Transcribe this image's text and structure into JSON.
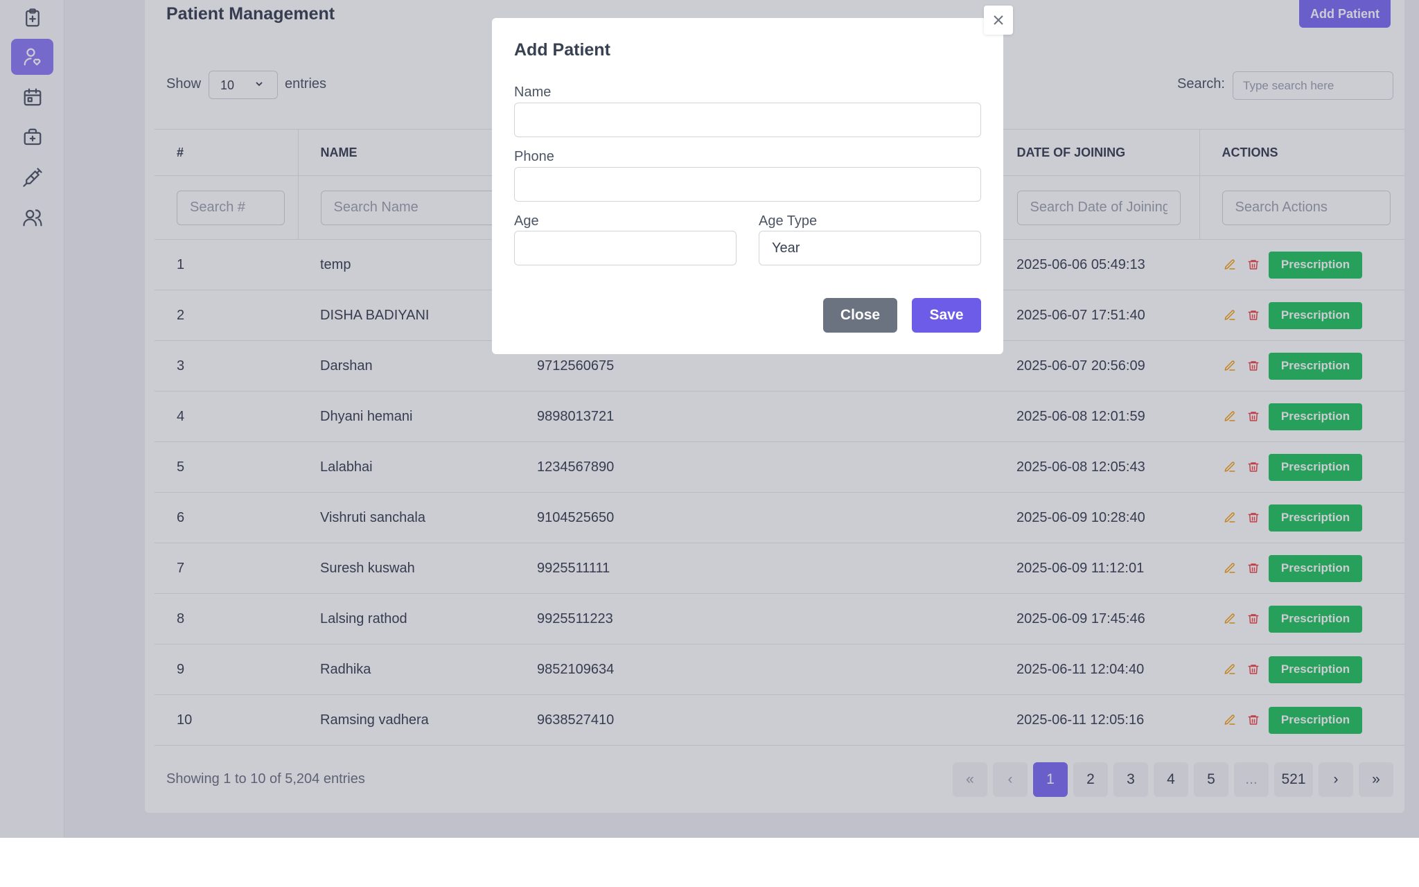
{
  "sidebar": {
    "items": [
      {
        "icon": "clipboard-icon",
        "active": false
      },
      {
        "icon": "user-heart-icon",
        "active": true
      },
      {
        "icon": "calendar-icon",
        "active": false
      },
      {
        "icon": "medical-bag-icon",
        "active": false
      },
      {
        "icon": "syringe-icon",
        "active": false
      },
      {
        "icon": "users-icon",
        "active": false
      }
    ]
  },
  "header": {
    "title": "Patient Management",
    "add_button": "Add Patient"
  },
  "controls": {
    "show_label": "Show",
    "entries_value": "10",
    "entries_label": "entries",
    "search_label": "Search:",
    "search_placeholder": "Type search here"
  },
  "table": {
    "columns": [
      "#",
      "NAME",
      "",
      "DATE OF JOINING",
      "ACTIONS"
    ],
    "filters": [
      "Search #",
      "Search Name",
      "",
      "Search Date of Joining",
      "Search Actions"
    ],
    "action_label": "Prescription",
    "rows": [
      {
        "num": "1",
        "name": "temp",
        "phone": "",
        "date": "2025-06-06 05:49:13"
      },
      {
        "num": "2",
        "name": "DISHA BADIYANI",
        "phone": "",
        "date": "2025-06-07 17:51:40"
      },
      {
        "num": "3",
        "name": "Darshan",
        "phone": "9712560675",
        "date": "2025-06-07 20:56:09"
      },
      {
        "num": "4",
        "name": "Dhyani hemani",
        "phone": "9898013721",
        "date": "2025-06-08 12:01:59"
      },
      {
        "num": "5",
        "name": "Lalabhai",
        "phone": "1234567890",
        "date": "2025-06-08 12:05:43"
      },
      {
        "num": "6",
        "name": "Vishruti sanchala",
        "phone": "9104525650",
        "date": "2025-06-09 10:28:40"
      },
      {
        "num": "7",
        "name": "Suresh kuswah",
        "phone": "9925511111",
        "date": "2025-06-09 11:12:01"
      },
      {
        "num": "8",
        "name": "Lalsing rathod",
        "phone": "9925511223",
        "date": "2025-06-09 17:45:46"
      },
      {
        "num": "9",
        "name": "Radhika",
        "phone": "9852109634",
        "date": "2025-06-11 12:04:40"
      },
      {
        "num": "10",
        "name": "Ramsing vadhera",
        "phone": "9638527410",
        "date": "2025-06-11 12:05:16"
      }
    ]
  },
  "footer": {
    "showing": "Showing 1 to 10 of 5,204 entries",
    "pages": [
      "«",
      "‹",
      "1",
      "2",
      "3",
      "4",
      "5",
      "...",
      "521",
      "›",
      "»"
    ],
    "active_page": "1"
  },
  "modal": {
    "title": "Add Patient",
    "name_label": "Name",
    "name_value": "",
    "phone_label": "Phone",
    "phone_value": "",
    "age_label": "Age",
    "age_value": "",
    "age_type_label": "Age Type",
    "age_type_value": "Year",
    "close_button": "Close",
    "save_button": "Save"
  },
  "colors": {
    "accent": "#7c6cf5",
    "success": "#22c55e",
    "danger": "#ef4444",
    "warning": "#f59e0b"
  }
}
